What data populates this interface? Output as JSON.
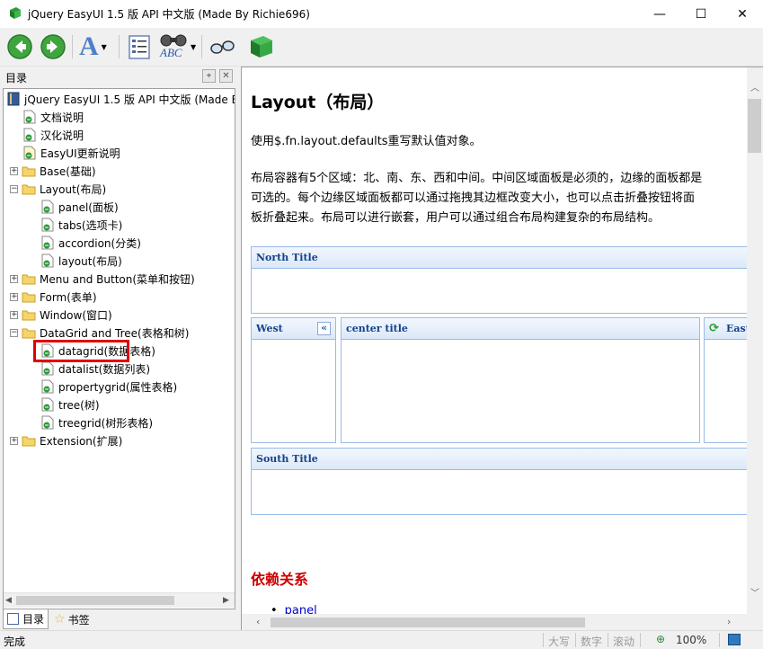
{
  "window": {
    "title": "jQuery EasyUI 1.5 版 API 中文版 (Made By Richie696)",
    "minimize": "—",
    "maximize": "☐",
    "close": "✕"
  },
  "toolbar": {
    "buttons": [
      {
        "name": "back",
        "icon": "arrow-left-icon"
      },
      {
        "name": "forward",
        "icon": "arrow-right-icon"
      },
      {
        "name": "font",
        "icon": "font-icon",
        "glyph": "A"
      },
      {
        "name": "contents",
        "icon": "toc-icon"
      },
      {
        "name": "find",
        "icon": "binoculars-icon",
        "glyph": "ABC"
      },
      {
        "name": "sync",
        "icon": "glasses-icon"
      },
      {
        "name": "book",
        "icon": "book-icon"
      }
    ]
  },
  "left_pane": {
    "title": "目录",
    "tree": [
      {
        "label": "jQuery EasyUI 1.5 版 API 中文版 (Made B",
        "level": 0,
        "type": "book"
      },
      {
        "label": "文档说明",
        "level": 1,
        "type": "page"
      },
      {
        "label": "汉化说明",
        "level": 1,
        "type": "page"
      },
      {
        "label": "EasyUI更新说明",
        "level": 1,
        "type": "note"
      },
      {
        "label": "Base(基础)",
        "level": 0,
        "type": "folder",
        "expander": "+"
      },
      {
        "label": "Layout(布局)",
        "level": 0,
        "type": "folder",
        "expander": "−"
      },
      {
        "label": "panel(面板)",
        "level": 2,
        "type": "page"
      },
      {
        "label": "tabs(选项卡)",
        "level": 2,
        "type": "page"
      },
      {
        "label": "accordion(分类)",
        "level": 2,
        "type": "page"
      },
      {
        "label": "layout(布局)",
        "level": 2,
        "type": "page",
        "selected": true
      },
      {
        "label": "Menu and Button(菜单和按钮)",
        "level": 0,
        "type": "folder",
        "expander": "+"
      },
      {
        "label": "Form(表单)",
        "level": 0,
        "type": "folder",
        "expander": "+"
      },
      {
        "label": "Window(窗口)",
        "level": 0,
        "type": "folder",
        "expander": "+"
      },
      {
        "label": "DataGrid and Tree(表格和树)",
        "level": 0,
        "type": "folder",
        "expander": "−"
      },
      {
        "label": "datagrid(数据表格)",
        "level": 2,
        "type": "page"
      },
      {
        "label": "datalist(数据列表)",
        "level": 2,
        "type": "page"
      },
      {
        "label": "propertygrid(属性表格)",
        "level": 2,
        "type": "page"
      },
      {
        "label": "tree(树)",
        "level": 2,
        "type": "page"
      },
      {
        "label": "treegrid(树形表格)",
        "level": 2,
        "type": "page"
      },
      {
        "label": "Extension(扩展)",
        "level": 0,
        "type": "folder",
        "expander": "+"
      }
    ],
    "tabs": [
      {
        "label": "目录",
        "icon": "toc-icon",
        "active": true
      },
      {
        "label": "书签",
        "icon": "star-icon",
        "active": false
      }
    ]
  },
  "document": {
    "heading": "Layout（布局）",
    "para1": "使用$.fn.layout.defaults重写默认值对象。",
    "para2_lines": [
      "布局容器有5个区域：北、南、东、西和中间。中间区域面板是必须的，边缘的面板都是",
      "可选的。每个边缘区域面板都可以通过拖拽其边框改变大小，也可以点击折叠按钮将面",
      "板折叠起来。布局可以进行嵌套，用户可以通过组合布局构建复杂的布局结构。"
    ],
    "panels": {
      "north": "North Title",
      "west": "West",
      "west_collapse": "«",
      "center": "center title",
      "east": "East",
      "south": "South Title"
    },
    "dependency_heading": "依赖关系",
    "dependency_item": "panel"
  },
  "status_bar": {
    "status": "完成",
    "caps": "大写",
    "num": "数字",
    "scroll": "滚动",
    "zoom": "100%"
  },
  "colors": {
    "heading_red": "#cc0000",
    "panel_border": "#99bbe8",
    "panel_title": "#15428b",
    "highlight": "#e00000"
  }
}
